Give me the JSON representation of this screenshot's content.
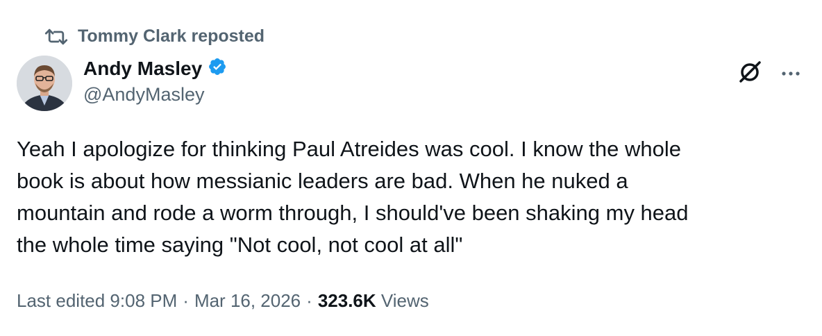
{
  "repost": {
    "icon": "repost-icon",
    "text": "Tommy Clark reposted"
  },
  "author": {
    "display_name": "Andy Masley",
    "handle": "@AndyMasley",
    "verified_icon": "verified-badge-icon",
    "avatar": "profile-avatar"
  },
  "actions": {
    "grok_icon": "grok-icon",
    "more_icon": "more-options-icon"
  },
  "tweet": {
    "text": "Yeah I apologize for thinking Paul Atreides was cool. I know the whole\nbook is about how messianic leaders are bad. When he nuked a\nmountain and rode a worm through, I should've been shaking my head\nthe whole time saying \"Not cool, not cool at all\""
  },
  "meta": {
    "edited_time": "Last edited 9:08 PM",
    "dot": "·",
    "date": "Mar 16, 2026",
    "views_count": "323.6K",
    "views_label": "Views"
  },
  "colors": {
    "verified_blue": "#1d9bf0",
    "secondary_text": "#536471",
    "primary_text": "#0f1419"
  }
}
